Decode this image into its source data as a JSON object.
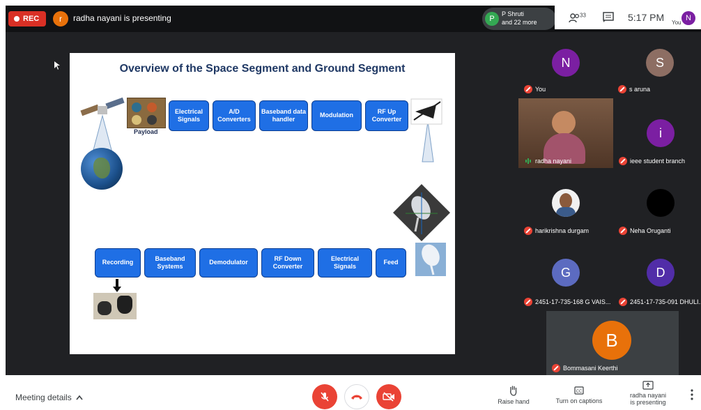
{
  "topbar": {
    "rec_label": "REC",
    "presenter_initial": "r",
    "presenter_text": "radha nayani is presenting",
    "participants_chip": {
      "initial": "P",
      "line1": "P Shruti",
      "line2": "and 22 more"
    },
    "people_count": "33",
    "time": "5:17 PM",
    "you_label": "You",
    "you_initial": "N"
  },
  "slide": {
    "title": "Overview of the Space Segment and Ground Segment",
    "payload_label": "Payload",
    "top_row": [
      "Electrical Signals",
      "A/D Converters",
      "Baseband data handler",
      "Modulation",
      "RF Up Converter"
    ],
    "bottom_row": [
      "Recording",
      "Baseband Systems",
      "Demodulator",
      "RF Down Converter",
      "Electrical Signals",
      "Feed"
    ]
  },
  "gallery": [
    {
      "initial": "N",
      "name": "You",
      "color": "#7b1fa2",
      "mic": "off"
    },
    {
      "initial": "S",
      "name": "s aruna",
      "color": "#8d6e63",
      "mic": "off"
    },
    {
      "initial": "",
      "name": "radha nayani",
      "color": "#5d4037",
      "mic": "on"
    },
    {
      "initial": "i",
      "name": "ieee student branch",
      "color": "#7b1fa2",
      "mic": "off"
    },
    {
      "initial": "",
      "name": "harikrishna durgam",
      "color": "#ffffff",
      "mic": "off"
    },
    {
      "initial": "",
      "name": "Neha Oruganti",
      "color": "#000000",
      "mic": "off"
    },
    {
      "initial": "G",
      "name": "2451-17-735-168 G VAIS...",
      "color": "#5c6bc0",
      "mic": "off"
    },
    {
      "initial": "D",
      "name": "2451-17-735-091 DHULI...",
      "color": "#512da8",
      "mic": "off"
    },
    {
      "initial": "B",
      "name": "Bommasani Keerthi",
      "color": "#e8710a",
      "mic": "off"
    }
  ],
  "bottom": {
    "meeting_details": "Meeting details",
    "raise_hand": "Raise hand",
    "captions": "Turn on captions",
    "presenting_line1": "radha nayani",
    "presenting_line2": "is presenting"
  },
  "colors": {
    "mic_off": "#ea4335",
    "rec": "#d93025",
    "box": "#1f6fe5"
  }
}
